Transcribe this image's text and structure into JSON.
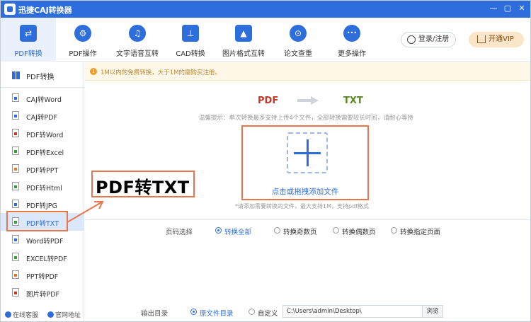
{
  "app": {
    "title": "迅捷CAJ转换器"
  },
  "window": {
    "min": "—",
    "max": "▢",
    "close": "✕"
  },
  "toolbar": {
    "tools": [
      {
        "label": "PDF转换",
        "icon": "swap-icon",
        "glyph": "⇄"
      },
      {
        "label": "PDF操作",
        "icon": "gear-icon",
        "glyph": "⚙"
      },
      {
        "label": "文字语音互转",
        "icon": "voice-icon",
        "glyph": "♫"
      },
      {
        "label": "CAD转换",
        "icon": "cad-icon",
        "glyph": "⊥"
      },
      {
        "label": "图片格式互转",
        "icon": "image-icon",
        "glyph": "▲"
      },
      {
        "label": "论文查重",
        "icon": "doc-search-icon",
        "glyph": "⊙"
      },
      {
        "label": "更多操作",
        "icon": "more-icon",
        "glyph": "•••"
      }
    ],
    "login": "登录/注册",
    "vip": "开通VIP"
  },
  "sidebar": {
    "header": "PDF转换",
    "items": [
      {
        "label": "CAJ转Word",
        "color": "#2e6ddc"
      },
      {
        "label": "CAJ转PDF",
        "color": "#2e6ddc"
      },
      {
        "label": "PDF转Word",
        "color": "#c0392b"
      },
      {
        "label": "PDF转Excel",
        "color": "#3a9a3a"
      },
      {
        "label": "PDF转PPT",
        "color": "#e07a2f"
      },
      {
        "label": "PDF转Html",
        "color": "#3a9a3a"
      },
      {
        "label": "PDF转JPG",
        "color": "#2e6ddc"
      },
      {
        "label": "PDF转TXT",
        "color": "#3a9a3a"
      },
      {
        "label": "Word转PDF",
        "color": "#2e6ddc"
      },
      {
        "label": "EXCEL转PDF",
        "color": "#3a9a3a"
      },
      {
        "label": "PPT转PDF",
        "color": "#e07a2f"
      },
      {
        "label": "图片转PDF",
        "color": "#c0392b"
      }
    ],
    "selected_index": 7,
    "footer": {
      "service": "在线客服",
      "website": "官网地址"
    }
  },
  "notice": {
    "icon": "!",
    "text": "1M以内的免费转换，大于1M的需购买注册。"
  },
  "conversion": {
    "from": "PDF",
    "to": "TXT"
  },
  "tip": "温馨提示：单次转换最多支持上传4个文件，全部转换需要较长时间，请耐心等待",
  "upload": {
    "label": "点击或拖拽添加文件",
    "hint": "*请添加需要转换的文件，最大支持1M，支持pdf格式"
  },
  "page_select": {
    "label": "页码选择",
    "options": [
      "转换全部",
      "转换奇数页",
      "转换偶数页",
      "转换指定页面"
    ],
    "selected": "转换全部"
  },
  "output": {
    "label": "输出目录",
    "options": [
      "原文件目录",
      "自定义"
    ],
    "selected": "原文件目录",
    "path": "C:\\Users\\admin\\Desktop\\",
    "browse": "浏览"
  },
  "annotation": {
    "text": "PDF转TXT"
  },
  "colors": {
    "accent": "#2e6ddc",
    "highlight": "#e8764a"
  }
}
